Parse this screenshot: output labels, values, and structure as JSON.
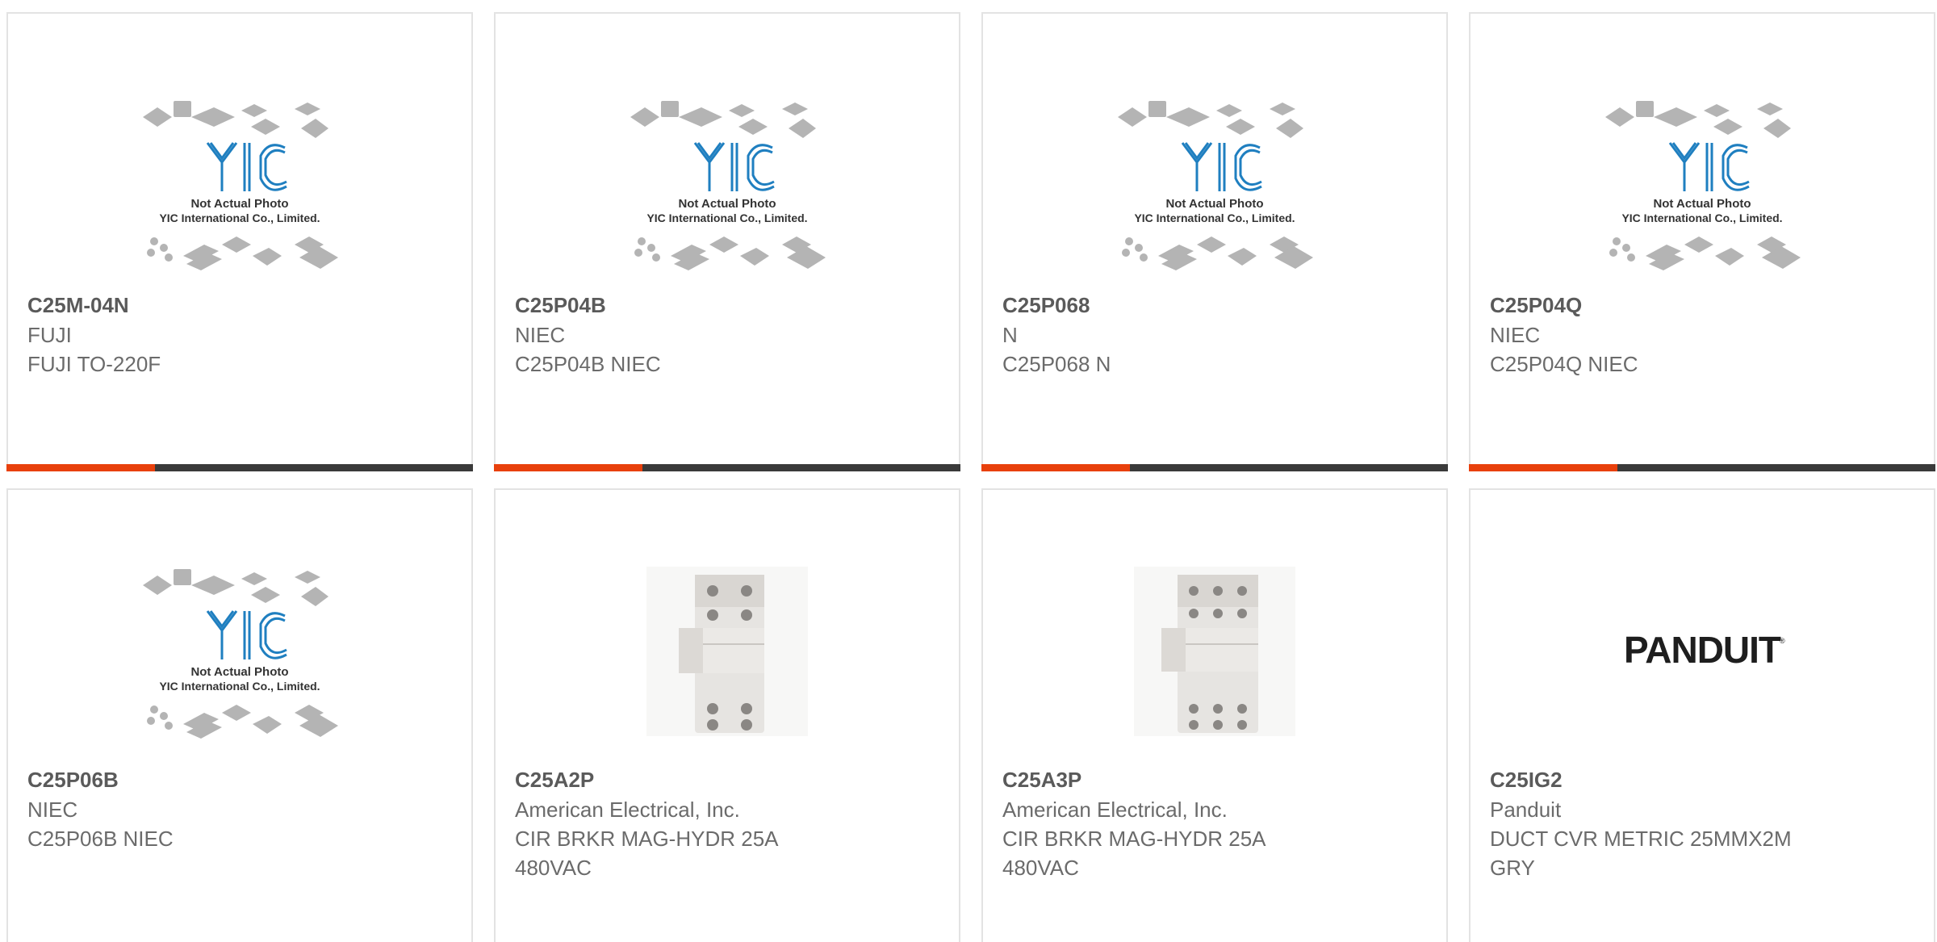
{
  "colors": {
    "accent": "#e8400c",
    "bar": "#3a3a3a",
    "border": "#e3e3e3",
    "yic_blue": "#1f7fc0"
  },
  "products": [
    {
      "part": "C25M-04N",
      "manufacturer": "FUJI",
      "desc1": "FUJI TO-220F",
      "desc2": "",
      "image": "yic-placeholder",
      "photo_note": "Not Actual Photo",
      "photo_company": "YIC International Co., Limited."
    },
    {
      "part": "C25P04B",
      "manufacturer": "NIEC",
      "desc1": "C25P04B NIEC",
      "desc2": "",
      "image": "yic-placeholder",
      "photo_note": "Not Actual Photo",
      "photo_company": "YIC International Co., Limited."
    },
    {
      "part": "C25P068",
      "manufacturer": "N",
      "desc1": "C25P068 N",
      "desc2": "",
      "image": "yic-placeholder",
      "photo_note": "Not Actual Photo",
      "photo_company": "YIC International Co., Limited."
    },
    {
      "part": "C25P04Q",
      "manufacturer": "NIEC",
      "desc1": "C25P04Q NIEC",
      "desc2": "",
      "image": "yic-placeholder",
      "photo_note": "Not Actual Photo",
      "photo_company": "YIC International Co., Limited."
    },
    {
      "part": "C25P06B",
      "manufacturer": "NIEC",
      "desc1": "C25P06B NIEC",
      "desc2": "",
      "image": "yic-placeholder",
      "photo_note": "Not Actual Photo",
      "photo_company": "YIC International Co., Limited."
    },
    {
      "part": "C25A2P",
      "manufacturer": "American Electrical, Inc.",
      "desc1": "CIR BRKR MAG-HYDR 25A",
      "desc2": "480VAC",
      "image": "circuit-breaker-2pole"
    },
    {
      "part": "C25A3P",
      "manufacturer": "American Electrical, Inc.",
      "desc1": "CIR BRKR MAG-HYDR 25A",
      "desc2": "480VAC",
      "image": "circuit-breaker-3pole"
    },
    {
      "part": "C25IG2",
      "manufacturer": "Panduit",
      "desc1": "DUCT CVR METRIC 25MMX2M",
      "desc2": "GRY",
      "image": "panduit-logo",
      "logo_text": "PANDUIT"
    }
  ]
}
